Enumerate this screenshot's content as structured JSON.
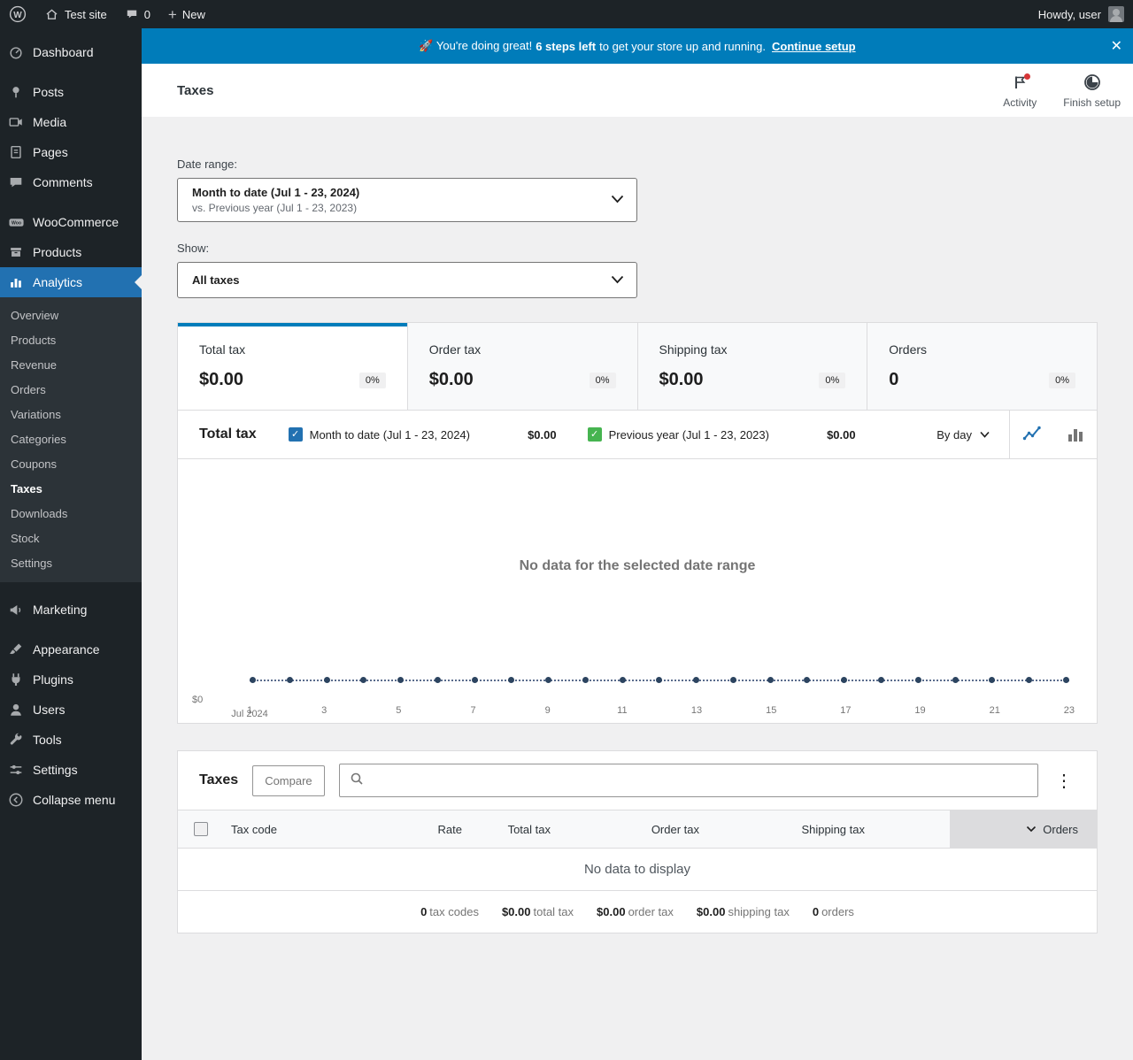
{
  "icons": {
    "close": "✕",
    "kebab": "⋮",
    "check": "✓",
    "plus": "+"
  },
  "admin_bar": {
    "site_name": "Test site",
    "comments_count": "0",
    "new_label": "New",
    "howdy": "Howdy, user"
  },
  "banner": {
    "pre": "🚀 You're doing great!",
    "steps": "6 steps left",
    "rest": "to get your store up and running.",
    "cta": "Continue setup"
  },
  "header": {
    "title": "Taxes",
    "activity": "Activity",
    "finish_setup": "Finish setup"
  },
  "filters": {
    "date_range_label": "Date range:",
    "date_range_value": "Month to date (Jul 1 - 23, 2024)",
    "date_range_compare": "vs. Previous year (Jul 1 - 23, 2023)",
    "show_label": "Show:",
    "show_value": "All taxes"
  },
  "summary_cards": [
    {
      "label": "Total tax",
      "value": "$0.00",
      "delta": "0%"
    },
    {
      "label": "Order tax",
      "value": "$0.00",
      "delta": "0%"
    },
    {
      "label": "Shipping tax",
      "value": "$0.00",
      "delta": "0%"
    },
    {
      "label": "Orders",
      "value": "0",
      "delta": "0%"
    }
  ],
  "chart": {
    "title": "Total tax",
    "series": [
      {
        "label": "Month to date (Jul 1 - 23, 2024)",
        "value": "$0.00"
      },
      {
        "label": "Previous year (Jul 1 - 23, 2023)",
        "value": "$0.00"
      }
    ],
    "interval": "By day",
    "empty": "No data for the selected date range",
    "y_zero": "$0",
    "month_label": "Jul 2024",
    "ticks": [
      "1",
      "3",
      "5",
      "7",
      "9",
      "11",
      "13",
      "15",
      "17",
      "19",
      "21",
      "23"
    ]
  },
  "chart_data": {
    "type": "line",
    "title": "Total tax",
    "xlabel": "Jul 2024",
    "ylabel": "",
    "x": [
      1,
      2,
      3,
      4,
      5,
      6,
      7,
      8,
      9,
      10,
      11,
      12,
      13,
      14,
      15,
      16,
      17,
      18,
      19,
      20,
      21,
      22,
      23
    ],
    "series": [
      {
        "name": "Month to date (Jul 1 - 23, 2024)",
        "values": [
          0,
          0,
          0,
          0,
          0,
          0,
          0,
          0,
          0,
          0,
          0,
          0,
          0,
          0,
          0,
          0,
          0,
          0,
          0,
          0,
          0,
          0,
          0
        ]
      },
      {
        "name": "Previous year (Jul 1 - 23, 2023)",
        "values": [
          0,
          0,
          0,
          0,
          0,
          0,
          0,
          0,
          0,
          0,
          0,
          0,
          0,
          0,
          0,
          0,
          0,
          0,
          0,
          0,
          0,
          0,
          0
        ]
      }
    ],
    "ylim": [
      0,
      0
    ],
    "y_tick_labels": [
      "$0"
    ],
    "legend_position": "top",
    "annotation": "No data for the selected date range"
  },
  "table": {
    "title": "Taxes",
    "compare": "Compare",
    "headers": [
      "Tax code",
      "Rate",
      "Total tax",
      "Order tax",
      "Shipping tax",
      "Orders"
    ],
    "empty": "No data to display",
    "totals": [
      {
        "v": "0",
        "l": "tax codes"
      },
      {
        "v": "$0.00",
        "l": "total tax"
      },
      {
        "v": "$0.00",
        "l": "order tax"
      },
      {
        "v": "$0.00",
        "l": "shipping tax"
      },
      {
        "v": "0",
        "l": "orders"
      }
    ]
  },
  "sidebar": {
    "items": [
      {
        "label": "Dashboard"
      },
      {
        "label": "Posts"
      },
      {
        "label": "Media"
      },
      {
        "label": "Pages"
      },
      {
        "label": "Comments"
      },
      {
        "label": "WooCommerce"
      },
      {
        "label": "Products"
      },
      {
        "label": "Analytics"
      },
      {
        "label": "Marketing"
      },
      {
        "label": "Appearance"
      },
      {
        "label": "Plugins"
      },
      {
        "label": "Users"
      },
      {
        "label": "Tools"
      },
      {
        "label": "Settings"
      },
      {
        "label": "Collapse menu"
      }
    ],
    "submenu": [
      {
        "label": "Overview"
      },
      {
        "label": "Products"
      },
      {
        "label": "Revenue"
      },
      {
        "label": "Orders"
      },
      {
        "label": "Variations"
      },
      {
        "label": "Categories"
      },
      {
        "label": "Coupons"
      },
      {
        "label": "Taxes"
      },
      {
        "label": "Downloads"
      },
      {
        "label": "Stock"
      },
      {
        "label": "Settings"
      }
    ],
    "colors": {
      "active_bg": "#2271b1",
      "bg": "#1d2327",
      "submenu_bg": "#2c3338"
    }
  }
}
